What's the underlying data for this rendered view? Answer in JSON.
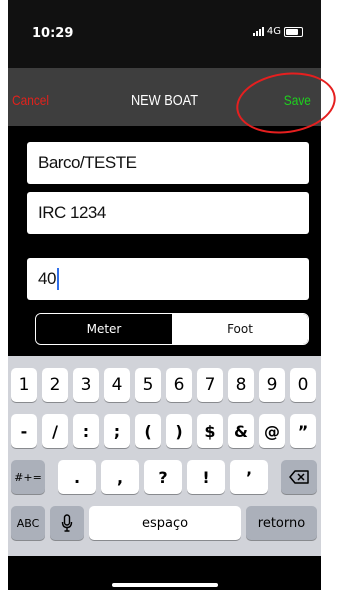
{
  "status_bar": {
    "time": "10:29",
    "network": "4G"
  },
  "navbar": {
    "cancel_label": "Cancel",
    "title": "NEW BOAT",
    "save_label": "Save"
  },
  "form": {
    "boat_name_value": "Barco/TESTE",
    "sail_number_value": "IRC 1234",
    "length_value": "40"
  },
  "units": {
    "options": [
      "Meter",
      "Foot"
    ],
    "selected": "Meter"
  },
  "keyboard": {
    "row1": [
      "1",
      "2",
      "3",
      "4",
      "5",
      "6",
      "7",
      "8",
      "9",
      "0"
    ],
    "row2": [
      "-",
      "/",
      ":",
      ";",
      "(",
      ")",
      "$",
      "&",
      "@",
      "”"
    ],
    "row3_mode_label": "#+=",
    "row3": [
      ".",
      ",",
      "?",
      "!",
      "’"
    ],
    "abc_label": "ABC",
    "space_label": "espaço",
    "return_label": "retorno"
  },
  "colors": {
    "cancel": "#e0221c",
    "save": "#1ed11e",
    "annotation_circle": "#e51f1f",
    "caret": "#2f6ee8"
  },
  "icons": [
    "signal-bars-icon",
    "battery-icon",
    "microphone-icon",
    "backspace-icon"
  ]
}
